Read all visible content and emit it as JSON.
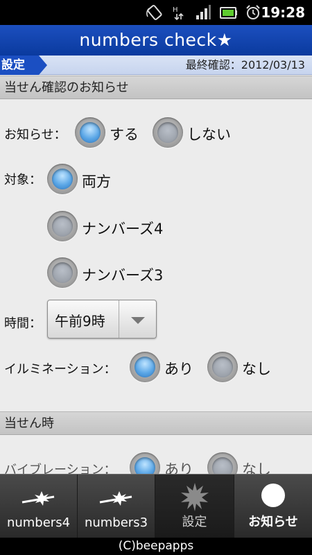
{
  "status": {
    "time": "19:28"
  },
  "header": {
    "title": "numbers check★"
  },
  "subheader": {
    "tag": "設定",
    "last_check": "最終確認：2012/03/13"
  },
  "section_notice": {
    "title": "当せん確認のお知らせ"
  },
  "notify": {
    "label": "お知らせ：",
    "options": [
      {
        "label": "する",
        "checked": true
      },
      {
        "label": "しない",
        "checked": false
      }
    ]
  },
  "target": {
    "label": "対象：",
    "options": [
      {
        "label": "両方",
        "checked": true
      },
      {
        "label": "ナンバーズ4",
        "checked": false
      },
      {
        "label": "ナンバーズ3",
        "checked": false
      }
    ]
  },
  "time": {
    "label": "時間：",
    "value": "午前9時"
  },
  "illumination": {
    "label": "イルミネーション：",
    "options": [
      {
        "label": "あり",
        "checked": true
      },
      {
        "label": "なし",
        "checked": false
      }
    ]
  },
  "section_win": {
    "title": "当せん時"
  },
  "vibration": {
    "label": "バイブレーション：",
    "options": [
      {
        "label": "あり",
        "checked": true
      },
      {
        "label": "なし",
        "checked": false
      }
    ]
  },
  "tabs": [
    {
      "label": "numbers4",
      "icon": "sparkle-wand-icon",
      "selected": false
    },
    {
      "label": "numbers3",
      "icon": "sparkle-wand-icon",
      "selected": false
    },
    {
      "label": "設定",
      "icon": "starburst-icon",
      "selected": true
    },
    {
      "label": "お知らせ",
      "icon": "white-circle-icon",
      "selected": false
    }
  ],
  "footer": {
    "copyright": "(C)beepapps"
  },
  "colors": {
    "title_bar": "#0a3a9e",
    "accent": "#1b4fc2",
    "radio_checked": "#5aa6e6"
  }
}
